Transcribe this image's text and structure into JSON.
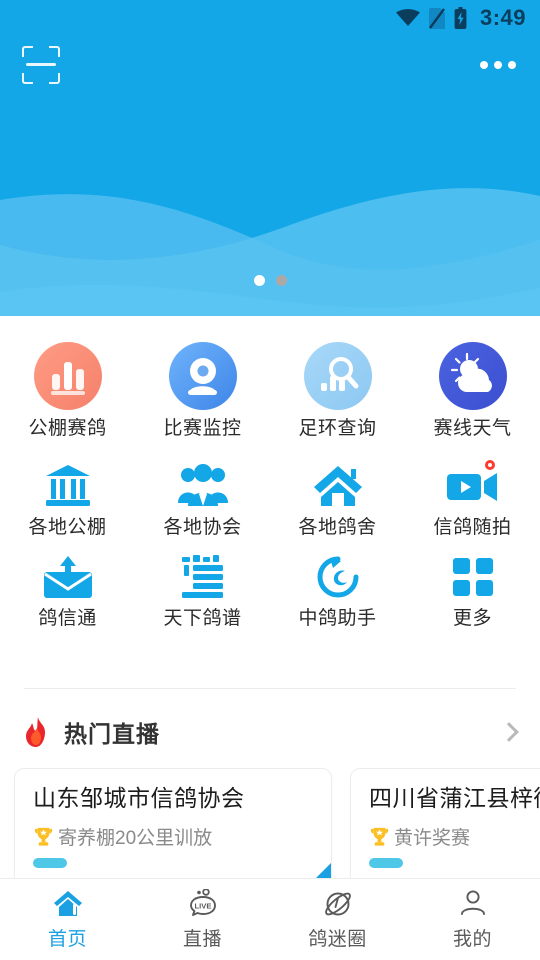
{
  "statusbar": {
    "time": "3:49",
    "icons": [
      "wifi-icon",
      "sim-card-off-icon",
      "battery-charging-icon"
    ]
  },
  "topbar": {
    "scan_icon": "scan-qr-icon",
    "more_icon": "more-horizontal-icon"
  },
  "banner": {
    "background_color": "#13A7E8",
    "wave_color": "#4FBDEF",
    "dots": [
      {
        "label": "1",
        "active": true
      },
      {
        "label": "2",
        "active": false
      }
    ]
  },
  "grid": {
    "rows": [
      {
        "items": [
          {
            "label": "公棚赛鸽",
            "icon": "bar-chart-icon",
            "style": "orange-circle",
            "badge": false
          },
          {
            "label": "比赛监控",
            "icon": "webcam-icon",
            "style": "blue-circle",
            "badge": false
          },
          {
            "label": "足环查询",
            "icon": "search-chart-icon",
            "style": "lightblue-circle",
            "badge": false
          },
          {
            "label": "赛线天气",
            "icon": "sun-cloud-icon",
            "style": "indigo-circle",
            "badge": false
          }
        ]
      },
      {
        "items": [
          {
            "label": "各地公棚",
            "icon": "bank-icon",
            "style": "flat-blue",
            "badge": false
          },
          {
            "label": "各地协会",
            "icon": "people-group-icon",
            "style": "flat-blue",
            "badge": false
          },
          {
            "label": "各地鸽舍",
            "icon": "home-icon",
            "style": "flat-blue",
            "badge": false
          },
          {
            "label": "信鸽随拍",
            "icon": "video-camera-icon",
            "style": "flat-blue",
            "badge": true
          }
        ]
      },
      {
        "items": [
          {
            "label": "鸽信通",
            "icon": "mail-upload-icon",
            "style": "flat-blue",
            "badge": false
          },
          {
            "label": "天下鸽谱",
            "icon": "pedigree-book-icon",
            "style": "flat-blue",
            "badge": false
          },
          {
            "label": "中鸽助手",
            "icon": "assistant-swirl-icon",
            "style": "flat-blue",
            "badge": false
          },
          {
            "label": "更多",
            "icon": "grid-squares-icon",
            "style": "flat-blue",
            "badge": false
          }
        ]
      }
    ]
  },
  "section": {
    "title": "热门直播",
    "icon": "fire-icon",
    "arrow_icon": "chevron-right-icon"
  },
  "live_cards": [
    {
      "title": "山东邹城市信鸽协会",
      "subtitle": "寄养棚20公里训放",
      "subtitle_icon": "trophy-icon",
      "ribbon": true
    },
    {
      "title": "四川省蒲江县梓衖",
      "subtitle": "黄许奖赛",
      "subtitle_icon": "trophy-icon",
      "ribbon": false
    }
  ],
  "bottom_nav": {
    "active_color": "#1BA1E2",
    "items": [
      {
        "label": "首页",
        "icon": "home-icon",
        "active": true
      },
      {
        "label": "直播",
        "icon": "live-bubble-icon",
        "active": false
      },
      {
        "label": "鸽迷圈",
        "icon": "planet-circle-icon",
        "active": false
      },
      {
        "label": "我的",
        "icon": "person-icon",
        "active": false
      }
    ]
  }
}
